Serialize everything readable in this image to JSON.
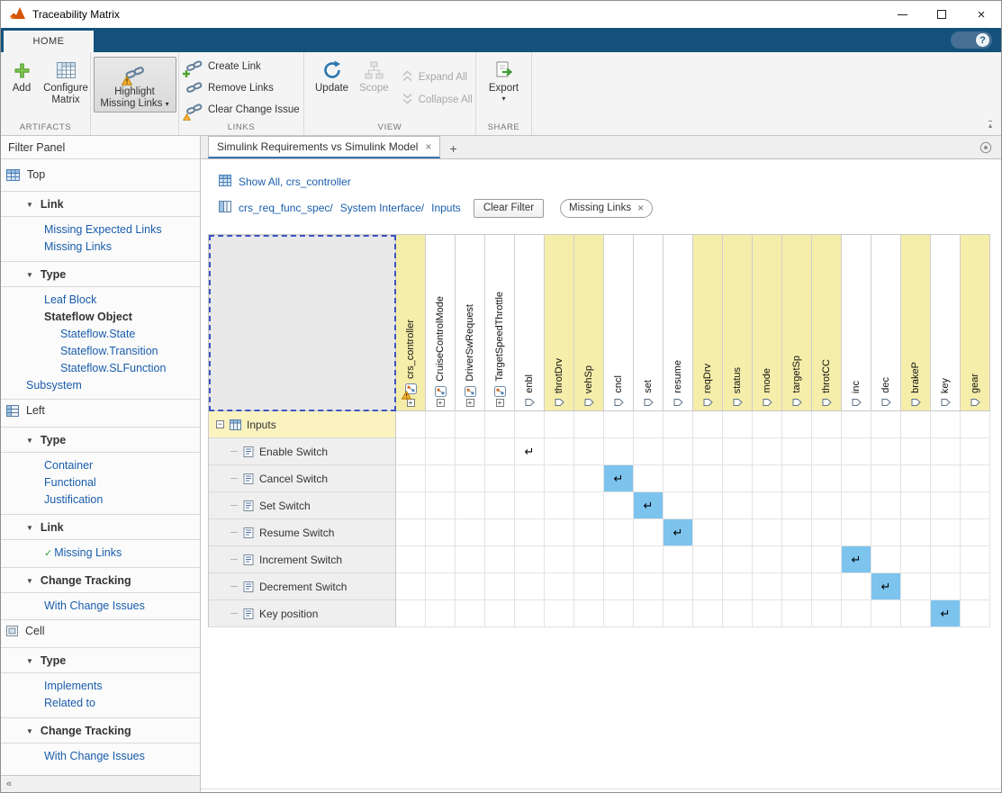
{
  "titlebar": {
    "title": "Traceability Matrix"
  },
  "icons": {
    "close": "×",
    "tab_close": "×",
    "chip_close": "×",
    "new_tab": "+",
    "dropdown_caret": "▾",
    "section_caret": "▼",
    "check": "✓",
    "link_arrow": "↵",
    "collapse_panel": "«",
    "ribbon_collapse": "▴",
    "help": "?",
    "expand_box": "+",
    "tree_minus": "−"
  },
  "colors": {
    "toolstrip_blue": "#14527c",
    "highlight_yellow": "#f5edaa",
    "group_row_yellow": "#faf3bf",
    "link_cell_blue": "#7cc3ee",
    "hyperlink_blue": "#1a5dab",
    "selection_dashed_blue": "#3d55c0"
  },
  "ribbon": {
    "tab_label": "HOME",
    "artifacts": {
      "label": "ARTIFACTS",
      "add_label": "Add",
      "configure_line1": "Configure",
      "configure_line2": "Matrix"
    },
    "highlight": {
      "line1": "Highlight",
      "line2": "Missing Links"
    },
    "links": {
      "label": "LINKS",
      "create_label": "Create Link",
      "remove_label": "Remove Links",
      "clear_label": "Clear Change Issue"
    },
    "view": {
      "label": "VIEW",
      "update_label": "Update",
      "scope_label": "Scope",
      "expand_label": "Expand All",
      "collapse_label": "Collapse All"
    },
    "share": {
      "label": "SHARE",
      "export_label": "Export"
    }
  },
  "sidebar": {
    "title": "Filter Panel",
    "blocks": [
      {
        "type": "root",
        "icon": "top-artifact-icon",
        "label": "Top"
      },
      {
        "type": "section",
        "label": "Link"
      },
      {
        "type": "item",
        "label": "Missing Expected Links",
        "indent": 1
      },
      {
        "type": "item",
        "label": "Missing Links",
        "indent": 1
      },
      {
        "type": "section",
        "label": "Type"
      },
      {
        "type": "item",
        "label": "Leaf Block",
        "indent": 1
      },
      {
        "type": "item",
        "label": "Stateflow Object",
        "indent": 1,
        "bold": true
      },
      {
        "type": "item",
        "label": "Stateflow.State",
        "indent": 2
      },
      {
        "type": "item",
        "label": "Stateflow.Transition",
        "indent": 2
      },
      {
        "type": "item",
        "label": "Stateflow.SLFunction",
        "indent": 2
      },
      {
        "type": "item",
        "label": "Subsystem",
        "indent": 0
      },
      {
        "type": "root",
        "icon": "left-artifact-icon",
        "label": "Left",
        "divider_before": true
      },
      {
        "type": "section",
        "label": "Type"
      },
      {
        "type": "item",
        "label": "Container",
        "indent": 1
      },
      {
        "type": "item",
        "label": "Functional",
        "indent": 1
      },
      {
        "type": "item",
        "label": "Justification",
        "indent": 1
      },
      {
        "type": "section",
        "label": "Link"
      },
      {
        "type": "item",
        "label": "Missing Links",
        "indent": 1,
        "checked": true
      },
      {
        "type": "section",
        "label": "Change Tracking"
      },
      {
        "type": "item",
        "label": "With Change Issues",
        "indent": 1
      },
      {
        "type": "root",
        "icon": "cell-artifact-icon",
        "label": "Cell",
        "divider_before": true
      },
      {
        "type": "section",
        "label": "Type"
      },
      {
        "type": "item",
        "label": "Implements",
        "indent": 1
      },
      {
        "type": "item",
        "label": "Related to",
        "indent": 1
      },
      {
        "type": "section",
        "label": "Change Tracking"
      },
      {
        "type": "item",
        "label": "With Change Issues",
        "indent": 1
      }
    ]
  },
  "doc": {
    "tab_title": "Simulink Requirements vs Simulink Model",
    "breadcrumb1": "Show All, crs_controller",
    "breadcrumb2_parts": [
      "crs_req_func_spec/",
      "System Interface/",
      "Inputs"
    ],
    "clear_filter_label": "Clear Filter",
    "filter_chip": {
      "label": "Missing Links"
    }
  },
  "matrix": {
    "columns": [
      {
        "label": "crs_controller",
        "highlight": true,
        "icon": "stateflow-warning",
        "expand": true
      },
      {
        "label": "CruiseControlMode",
        "highlight": false,
        "icon": "chart",
        "expand": true
      },
      {
        "label": "DriverSwRequest",
        "highlight": false,
        "icon": "chart",
        "expand": true
      },
      {
        "label": "TargetSpeedThrottle",
        "highlight": false,
        "icon": "chart",
        "expand": true
      },
      {
        "label": "enbl",
        "highlight": false,
        "icon": "port"
      },
      {
        "label": "throtDrv",
        "highlight": true,
        "icon": "port"
      },
      {
        "label": "vehSp",
        "highlight": true,
        "icon": "port"
      },
      {
        "label": "cncl",
        "highlight": false,
        "icon": "port"
      },
      {
        "label": "set",
        "highlight": false,
        "icon": "port"
      },
      {
        "label": "resume",
        "highlight": false,
        "icon": "port"
      },
      {
        "label": "reqDrv",
        "highlight": true,
        "icon": "port"
      },
      {
        "label": "status",
        "highlight": true,
        "icon": "port"
      },
      {
        "label": "mode",
        "highlight": true,
        "icon": "port"
      },
      {
        "label": "targetSp",
        "highlight": true,
        "icon": "port"
      },
      {
        "label": "throtCC",
        "highlight": true,
        "icon": "port"
      },
      {
        "label": "inc",
        "highlight": false,
        "icon": "port"
      },
      {
        "label": "dec",
        "highlight": false,
        "icon": "port"
      },
      {
        "label": "brakeP",
        "highlight": true,
        "icon": "port"
      },
      {
        "label": "key",
        "highlight": false,
        "icon": "port"
      },
      {
        "label": "gear",
        "highlight": true,
        "icon": "port"
      }
    ],
    "rows": [
      {
        "label": "Inputs",
        "type": "group"
      },
      {
        "label": "Enable Switch"
      },
      {
        "label": "Cancel Switch"
      },
      {
        "label": "Set Switch"
      },
      {
        "label": "Resume Switch"
      },
      {
        "label": "Increment Switch"
      },
      {
        "label": "Decrement Switch"
      },
      {
        "label": "Key position"
      }
    ],
    "links": [
      {
        "row": 1,
        "col": 4,
        "style": "plain"
      },
      {
        "row": 2,
        "col": 7,
        "style": "selected"
      },
      {
        "row": 3,
        "col": 8,
        "style": "selected"
      },
      {
        "row": 4,
        "col": 9,
        "style": "selected"
      },
      {
        "row": 5,
        "col": 15,
        "style": "selected"
      },
      {
        "row": 6,
        "col": 16,
        "style": "selected"
      },
      {
        "row": 7,
        "col": 18,
        "style": "selected"
      }
    ]
  }
}
